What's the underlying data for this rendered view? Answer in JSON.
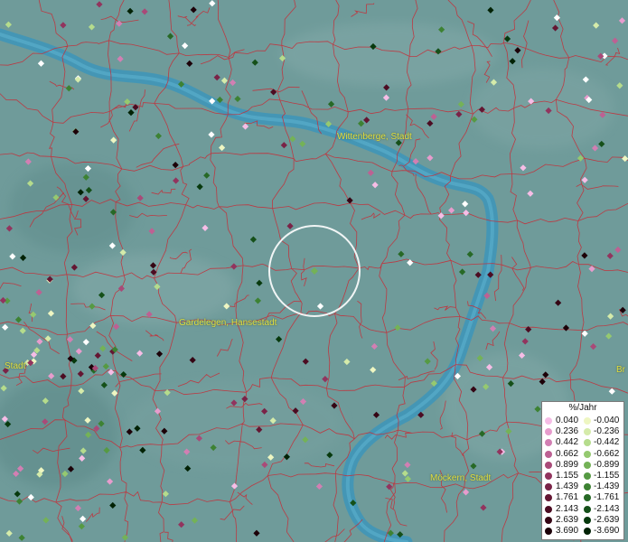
{
  "places": [
    {
      "name": "Wittenberge, Stadt",
      "key": "wittenberge"
    },
    {
      "name": "Gardelegen, Hansestadt",
      "key": "gardelegen"
    },
    {
      "name": "Möckern, Stadt",
      "key": "moeckern"
    },
    {
      "name": "Stadt",
      "key": "stadt-left"
    },
    {
      "name": "Br",
      "key": "br-right"
    }
  ],
  "legend": {
    "title": "%/Jahr",
    "positive": [
      {
        "value": "0.040",
        "color": "#f6bde6"
      },
      {
        "value": "0.236",
        "color": "#e79ccd"
      },
      {
        "value": "0.442",
        "color": "#d27fb3"
      },
      {
        "value": "0.662",
        "color": "#bd6193"
      },
      {
        "value": "0.899",
        "color": "#a94a78"
      },
      {
        "value": "1.155",
        "color": "#92345e"
      },
      {
        "value": "1.439",
        "color": "#7a2347"
      },
      {
        "value": "1.761",
        "color": "#641632"
      },
      {
        "value": "2.143",
        "color": "#4c0c22"
      },
      {
        "value": "2.639",
        "color": "#350514"
      },
      {
        "value": "3.690",
        "color": "#1c0008"
      }
    ],
    "negative": [
      {
        "value": "-0.040",
        "color": "#eef6c2"
      },
      {
        "value": "-0.236",
        "color": "#d5ebaa"
      },
      {
        "value": "-0.442",
        "color": "#b5dc8c"
      },
      {
        "value": "-0.662",
        "color": "#95c970"
      },
      {
        "value": "-0.899",
        "color": "#74b257"
      },
      {
        "value": "-1.155",
        "color": "#569a43"
      },
      {
        "value": "-1.439",
        "color": "#3d8233"
      },
      {
        "value": "-1.761",
        "color": "#276926"
      },
      {
        "value": "-2.143",
        "color": "#155019"
      },
      {
        "value": "-2.639",
        "color": "#07390d"
      },
      {
        "value": "-3.690",
        "color": "#022205"
      }
    ]
  },
  "colors": {
    "river": "#3d95ba",
    "boundary": "#c3303a",
    "land": "#6f9b9a",
    "label": "#e3e040",
    "circle": "#ffffff"
  }
}
